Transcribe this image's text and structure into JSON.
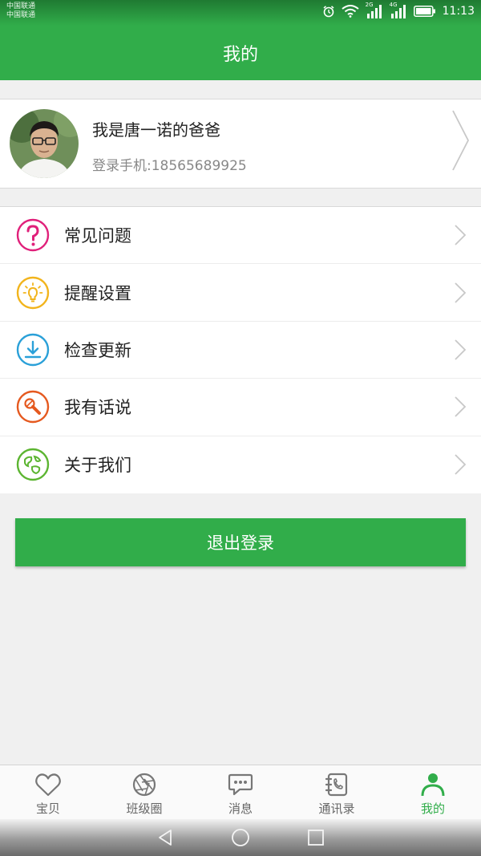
{
  "status": {
    "carrier1": "中国联通",
    "carrier2": "中国联通",
    "net1": "2G",
    "net2": "4G",
    "time": "11:13"
  },
  "header": {
    "title": "我的"
  },
  "profile": {
    "name": "我是唐一诺的爸爸",
    "phone": "登录手机:18565689925"
  },
  "menu": [
    {
      "label": "常见问题",
      "icon": "question-icon",
      "color": "#e0207a"
    },
    {
      "label": "提醒设置",
      "icon": "lightbulb-icon",
      "color": "#f2b41c"
    },
    {
      "label": "检查更新",
      "icon": "download-icon",
      "color": "#2aa0d8"
    },
    {
      "label": "我有话说",
      "icon": "microphone-icon",
      "color": "#e5591f"
    },
    {
      "label": "关于我们",
      "icon": "globe-icon",
      "color": "#5cb531"
    }
  ],
  "logout_label": "退出登录",
  "tabs": [
    {
      "label": "宝贝",
      "icon": "heart-icon"
    },
    {
      "label": "班级圈",
      "icon": "aperture-icon"
    },
    {
      "label": "消息",
      "icon": "chat-bubble-icon"
    },
    {
      "label": "通讯录",
      "icon": "contacts-book-icon"
    },
    {
      "label": "我的",
      "icon": "person-icon",
      "active": true
    }
  ],
  "colors": {
    "primary": "#31ad4a",
    "background": "#f0f0f0"
  }
}
